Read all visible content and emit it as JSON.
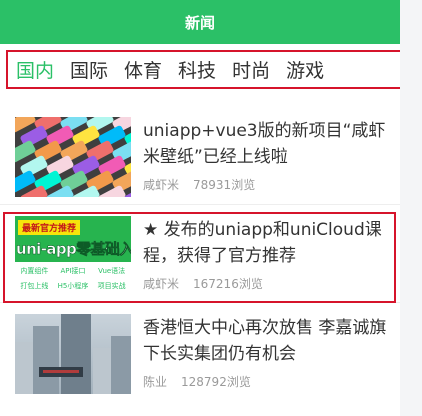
{
  "navbar": {
    "title": "新闻"
  },
  "tabs": [
    {
      "label": "国内",
      "active": true
    },
    {
      "label": "国际",
      "active": false
    },
    {
      "label": "体育",
      "active": false
    },
    {
      "label": "科技",
      "active": false
    },
    {
      "label": "时尚",
      "active": false
    },
    {
      "label": "游戏",
      "active": false
    }
  ],
  "news": [
    {
      "title": "uniapp+vue3版的新项目“咸虾米壁纸”已经上线啦",
      "author": "咸虾米",
      "views": "78931浏览"
    },
    {
      "title": "★ 发布的uniapp和uniCloud课程，获得了官方推荐",
      "author": "咸虾米",
      "views": "167216浏览",
      "thumb": {
        "tag": "最新官方推荐",
        "headline": "uni-app零基础入门",
        "features": [
          "内置组件",
          "API接口",
          "Vue语法",
          "打包上线",
          "H5小程序",
          "项目实战"
        ]
      }
    },
    {
      "title": "香港恒大中心再次放售 李嘉诚旗下长实集团仍有机会",
      "author": "陈业",
      "views": "128792浏览"
    }
  ],
  "colors": {
    "accent": "#2bc067",
    "highlight_border": "#d6142b"
  }
}
